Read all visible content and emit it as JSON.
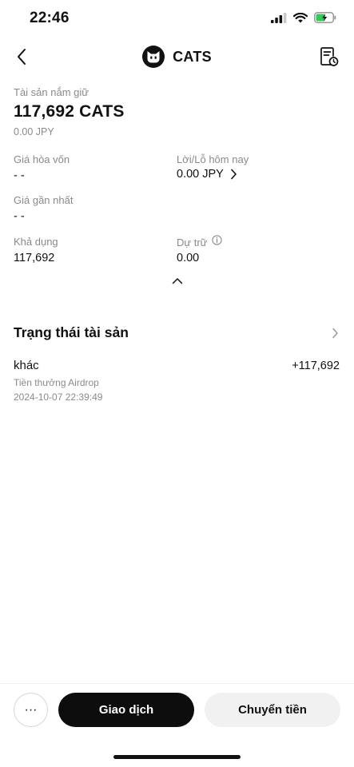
{
  "status_bar": {
    "time": "22:46",
    "icons": [
      "signal-icon",
      "wifi-icon",
      "battery-charging-icon"
    ],
    "battery_color": "#34c759"
  },
  "header": {
    "title": "CATS",
    "back_icon": "chevron-left-icon",
    "history_icon": "document-clock-icon"
  },
  "holdings": {
    "label": "Tài sản nắm giữ",
    "amount": "117,692 CATS",
    "fiat": "0.00 JPY"
  },
  "stats": {
    "breakeven_label": "Giá hòa vốn",
    "breakeven_value": "- -",
    "pnl_label": "Lời/Lỗ hôm nay",
    "pnl_value": "0.00 JPY",
    "last_price_label": "Giá gần nhất",
    "last_price_value": "- -",
    "available_label": "Khả dụng",
    "available_value": "117,692",
    "reserve_label": "Dự trữ",
    "reserve_value": "0.00"
  },
  "asset_status": {
    "title": "Trạng thái tài sản",
    "transactions": [
      {
        "type": "khác",
        "amount": "+117,692",
        "description": "Tiền thưởng Airdrop",
        "time": "2024-10-07 22:39:49"
      }
    ]
  },
  "bottom_bar": {
    "more_label": "···",
    "trade_label": "Giao dịch",
    "transfer_label": "Chuyển tiền"
  }
}
